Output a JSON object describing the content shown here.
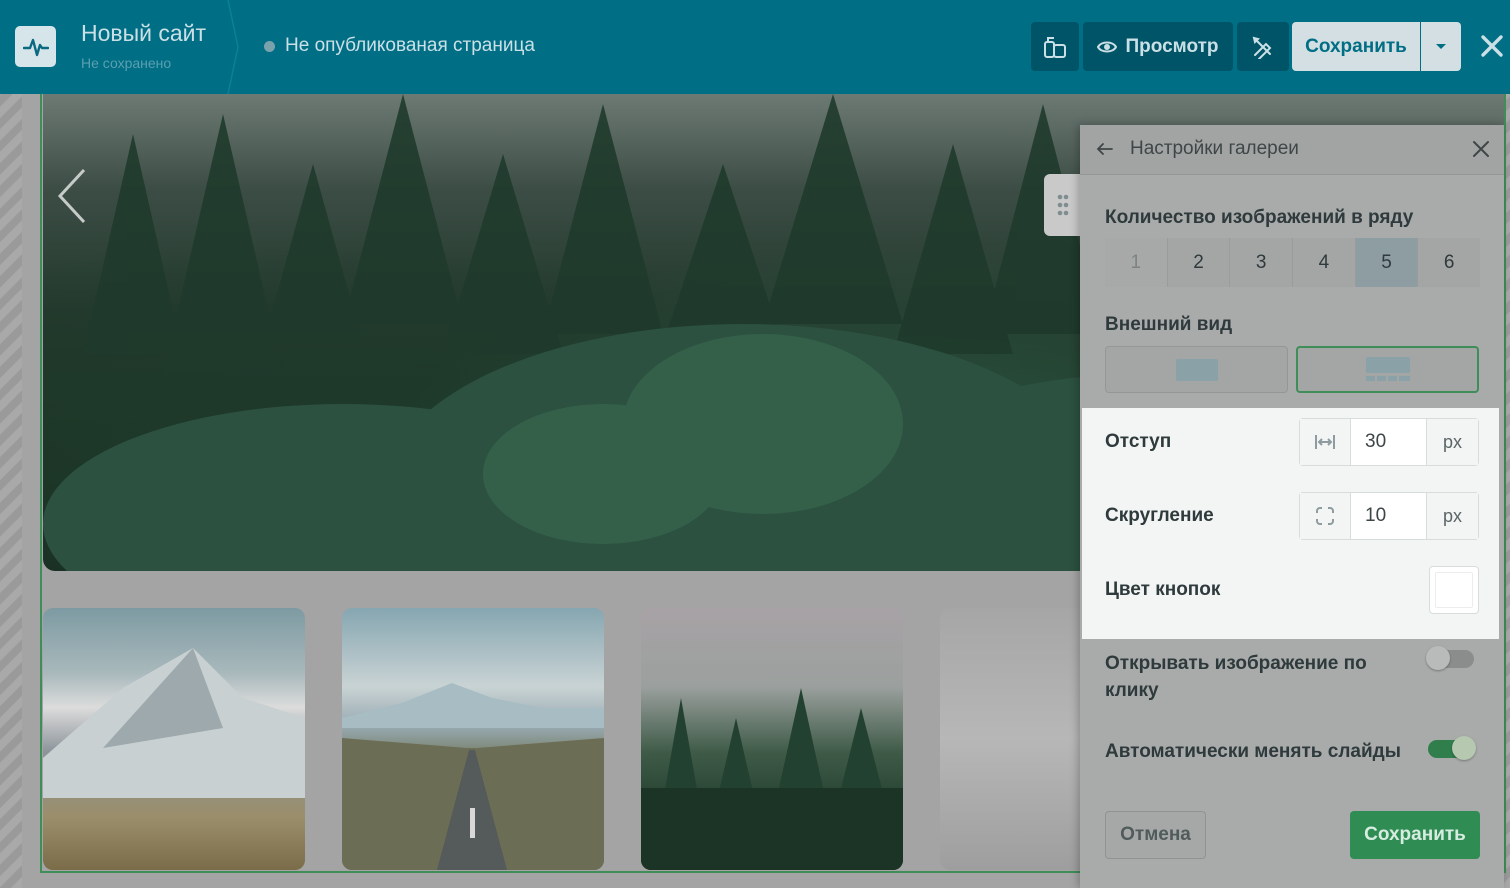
{
  "header": {
    "site_title": "Новый сайт",
    "site_subtitle": "Не сохранено",
    "page_status": "Не опубликованая страница",
    "preview_label": "Просмотр",
    "save_label": "Сохранить"
  },
  "panel": {
    "title": "Настройки галереи",
    "count_label": "Количество изображений в ряду",
    "count_options": [
      "1",
      "2",
      "3",
      "4",
      "5",
      "6"
    ],
    "count_selected": "5",
    "view_label": "Внешний вид",
    "view_selected": 2,
    "padding_label": "Отступ",
    "padding_value": "30",
    "padding_unit": "px",
    "radius_label": "Скругление",
    "radius_value": "10",
    "radius_unit": "px",
    "button_color_label": "Цвет кнопок",
    "button_color": "#ffffff",
    "open_on_click_label": "Открывать изображение по клику",
    "open_on_click": false,
    "autoplay_label": "Автоматически менять слайды",
    "autoplay": true,
    "cancel_label": "Отмена",
    "save_label": "Сохранить"
  },
  "colors": {
    "topbar": "#006e84",
    "accent_green": "#2f8d54",
    "selected_border": "#3f8d59"
  }
}
